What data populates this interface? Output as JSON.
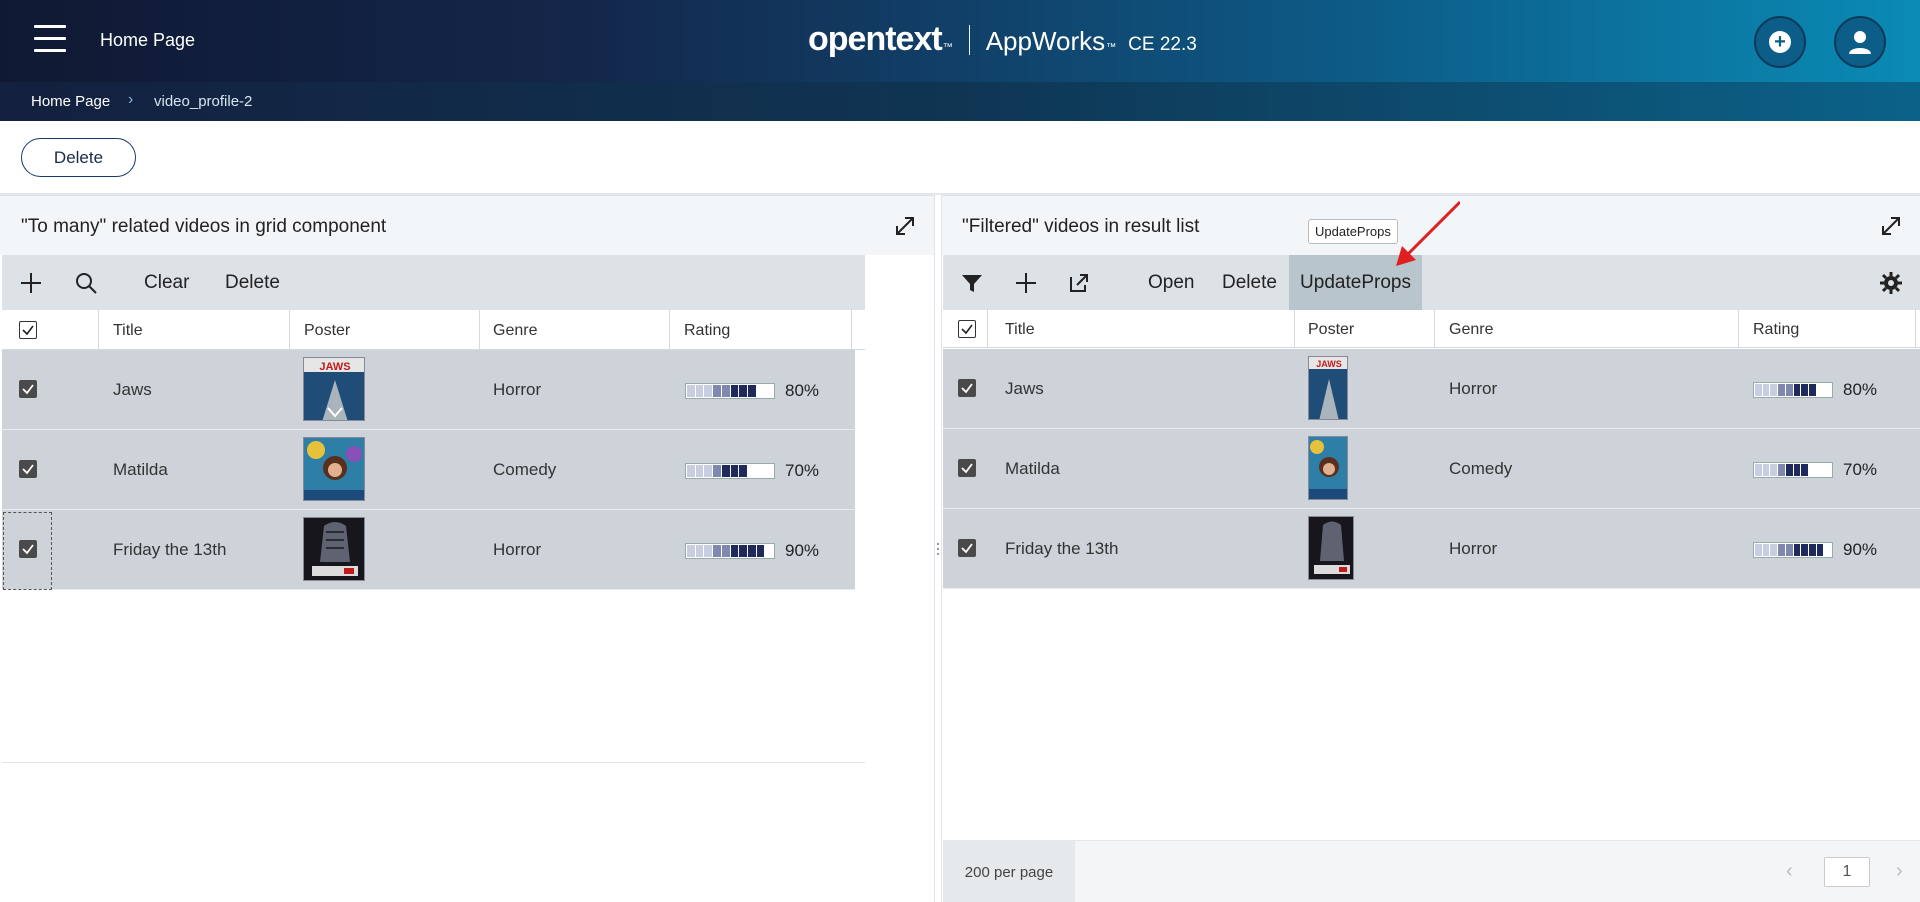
{
  "header": {
    "page_title": "Home Page",
    "brand_logo": "opentext",
    "brand_tm": "™",
    "app_name": "AppWorks",
    "app_tm": "™",
    "version": "CE 22.3"
  },
  "breadcrumb": {
    "home": "Home Page",
    "separator": "›",
    "current": "video_profile-2"
  },
  "actions": {
    "delete_label": "Delete"
  },
  "left_panel": {
    "title": "\"To many\" related videos in grid component",
    "toolbar": {
      "clear_label": "Clear",
      "delete_label": "Delete"
    },
    "columns": [
      "Title",
      "Poster",
      "Genre",
      "Rating"
    ],
    "rows": [
      {
        "title": "Jaws",
        "poster": "Jaws poster",
        "genre": "Horror",
        "rating_label": "80%",
        "rating": 0.8
      },
      {
        "title": "Matilda",
        "poster": "Matilda poster",
        "genre": "Comedy",
        "rating_label": "70%",
        "rating": 0.7
      },
      {
        "title": "Friday the 13th",
        "poster": "Friday the 13th poster",
        "genre": "Horror",
        "rating_label": "90%",
        "rating": 0.9
      }
    ]
  },
  "right_panel": {
    "title": "\"Filtered\" videos in result list",
    "toolbar": {
      "open_label": "Open",
      "delete_label": "Delete",
      "updateprops_label": "UpdateProps"
    },
    "tooltip": "UpdateProps",
    "columns": [
      "Title",
      "Poster",
      "Genre",
      "Rating"
    ],
    "rows": [
      {
        "title": "Jaws",
        "poster": "Jaws poster",
        "genre": "Horror",
        "rating_label": "80%",
        "rating": 0.8
      },
      {
        "title": "Matilda",
        "poster": "Matilda poster",
        "genre": "Comedy",
        "rating_label": "70%",
        "rating": 0.7
      },
      {
        "title": "Friday the 13th",
        "poster": "Friday the 13th poster",
        "genre": "Horror",
        "rating_label": "90%",
        "rating": 0.9
      }
    ],
    "pager": {
      "per_page": "200 per page",
      "current_page": "1",
      "prev": "‹",
      "next": "›"
    }
  },
  "colors": {
    "accent_red_arrow": "#e02020",
    "rating_dark": "#1e2a5c",
    "rating_light": "#c9cde0"
  }
}
